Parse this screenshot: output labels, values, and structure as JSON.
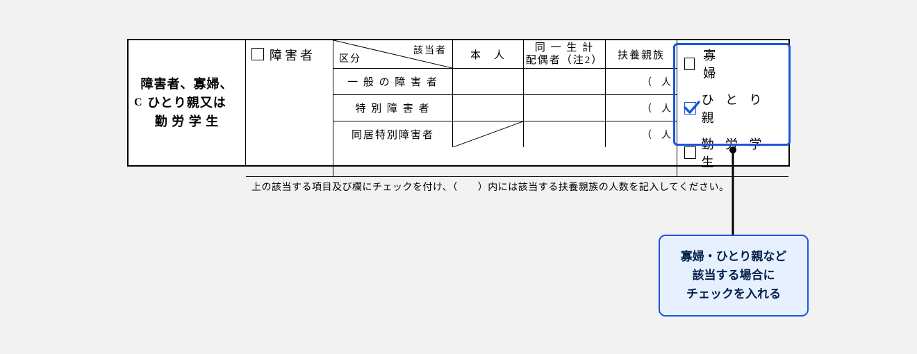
{
  "section": {
    "marker": "C",
    "title_l1": "障害者、寡婦、",
    "title_l2": "ひとり親又は",
    "title_l3": "勤 労 学 生"
  },
  "top_checkbox_label": "障害者",
  "inner": {
    "head": {
      "right": "該当者",
      "left": "区分",
      "honnin": "本　人",
      "haigu_l1": "同 一 生 計",
      "haigu_l2": "配偶者（注2）",
      "fuyou": "扶養親族"
    },
    "rows": [
      {
        "label": "一 般 の 障 害 者"
      },
      {
        "label": "特 別 障 害 者"
      },
      {
        "label": "同居特別障害者"
      }
    ],
    "fuyou_cell": "（　人"
  },
  "right": {
    "widow": "寡　　　婦",
    "single": "ひ と り 親",
    "student": "勤 労 学 生"
  },
  "footnote": "上の該当する項目及び欄にチェックを付け、（　　）内には該当する扶養親族の人数を記入してください。",
  "callout": {
    "l1": "寡婦・ひとり親など",
    "l2": "該当する場合に",
    "l3": "チェックを入れる"
  }
}
